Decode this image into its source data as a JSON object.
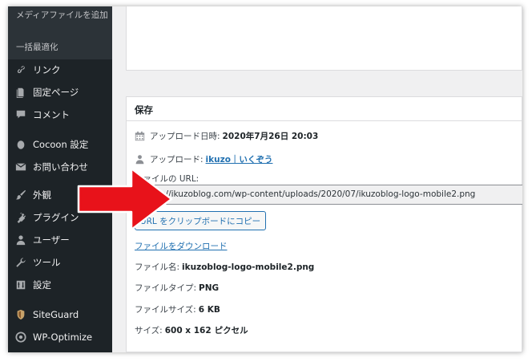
{
  "sidebar": {
    "submenu": [
      "メディアファイルを追加",
      "一括最適化"
    ],
    "items": [
      {
        "label": "リンク",
        "icon": "link-icon"
      },
      {
        "label": "固定ページ",
        "icon": "page-icon"
      },
      {
        "label": "コメント",
        "icon": "comment-icon"
      },
      {
        "label": "Cocoon 設定",
        "icon": "cocoon-icon"
      },
      {
        "label": "お問い合わせ",
        "icon": "mail-icon"
      },
      {
        "label": "外観",
        "icon": "brush-icon"
      },
      {
        "label": "プラグイン",
        "icon": "plugin-icon"
      },
      {
        "label": "ユーザー",
        "icon": "user-icon"
      },
      {
        "label": "ツール",
        "icon": "wrench-icon"
      },
      {
        "label": "設定",
        "icon": "settings-icon"
      },
      {
        "label": "SiteGuard",
        "icon": "siteguard-icon"
      },
      {
        "label": "WP-Optimize",
        "icon": "wp-optimize-icon"
      }
    ]
  },
  "panel": {
    "title": "保存",
    "upload_date_label": "アップロード日時:",
    "upload_date_value": "2020年7月26日 20:03",
    "uploader_label": "アップロード:",
    "uploader_value": "ikuzo｜いくぞう",
    "url_label": "ファイルの URL:",
    "url_value": "https://ikuzoblog.com/wp-content/uploads/2020/07/ikuzoblog-logo-mobile2.png",
    "copy_button": "URL をクリップボードにコピー",
    "download_link": "ファイルをダウンロード",
    "filename_label": "ファイル名:",
    "filename_value": "ikuzoblog-logo-mobile2.png",
    "filetype_label": "ファイルタイプ:",
    "filetype_value": "PNG",
    "filesize_label": "ファイルサイズ:",
    "filesize_value": "6 KB",
    "dimensions_label": "サイズ:",
    "dimensions_value": "600 x 162",
    "dimensions_unit": "ピクセル"
  },
  "colors": {
    "sidebar_bg": "#1d2327",
    "accent": "#2271b1",
    "arrow": "#e8121a"
  }
}
